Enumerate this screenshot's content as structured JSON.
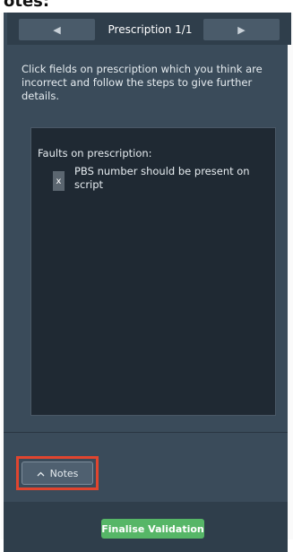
{
  "header_fragment": "otes:",
  "nav": {
    "prev_icon": "triangle-left-icon",
    "title": "Prescription 1/1",
    "next_icon": "triangle-right-icon"
  },
  "instructions": "Click fields on prescription which you think are incorrect and follow the steps to give further details.",
  "faults": {
    "title": "Faults on prescription:",
    "items": [
      {
        "remove_label": "x",
        "text": "PBS number should be present on script"
      }
    ]
  },
  "notes": {
    "label": "Notes",
    "icon": "chevron-up-icon"
  },
  "footer": {
    "finalise_label": "Finalise Validation"
  },
  "colors": {
    "panel_bg": "#3a4b5a",
    "box_bg": "#1f2933",
    "finalise_green": "#56b667",
    "highlight_red": "#e0452f"
  }
}
